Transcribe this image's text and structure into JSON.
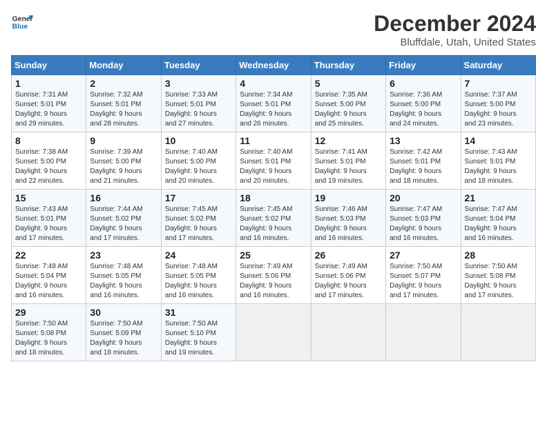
{
  "logo": {
    "line1": "General",
    "line2": "Blue"
  },
  "title": "December 2024",
  "subtitle": "Bluffdale, Utah, United States",
  "days_of_week": [
    "Sunday",
    "Monday",
    "Tuesday",
    "Wednesday",
    "Thursday",
    "Friday",
    "Saturday"
  ],
  "weeks": [
    [
      {
        "day": "1",
        "info": "Sunrise: 7:31 AM\nSunset: 5:01 PM\nDaylight: 9 hours\nand 29 minutes."
      },
      {
        "day": "2",
        "info": "Sunrise: 7:32 AM\nSunset: 5:01 PM\nDaylight: 9 hours\nand 28 minutes."
      },
      {
        "day": "3",
        "info": "Sunrise: 7:33 AM\nSunset: 5:01 PM\nDaylight: 9 hours\nand 27 minutes."
      },
      {
        "day": "4",
        "info": "Sunrise: 7:34 AM\nSunset: 5:01 PM\nDaylight: 9 hours\nand 26 minutes."
      },
      {
        "day": "5",
        "info": "Sunrise: 7:35 AM\nSunset: 5:00 PM\nDaylight: 9 hours\nand 25 minutes."
      },
      {
        "day": "6",
        "info": "Sunrise: 7:36 AM\nSunset: 5:00 PM\nDaylight: 9 hours\nand 24 minutes."
      },
      {
        "day": "7",
        "info": "Sunrise: 7:37 AM\nSunset: 5:00 PM\nDaylight: 9 hours\nand 23 minutes."
      }
    ],
    [
      {
        "day": "8",
        "info": "Sunrise: 7:38 AM\nSunset: 5:00 PM\nDaylight: 9 hours\nand 22 minutes."
      },
      {
        "day": "9",
        "info": "Sunrise: 7:39 AM\nSunset: 5:00 PM\nDaylight: 9 hours\nand 21 minutes."
      },
      {
        "day": "10",
        "info": "Sunrise: 7:40 AM\nSunset: 5:00 PM\nDaylight: 9 hours\nand 20 minutes."
      },
      {
        "day": "11",
        "info": "Sunrise: 7:40 AM\nSunset: 5:01 PM\nDaylight: 9 hours\nand 20 minutes."
      },
      {
        "day": "12",
        "info": "Sunrise: 7:41 AM\nSunset: 5:01 PM\nDaylight: 9 hours\nand 19 minutes."
      },
      {
        "day": "13",
        "info": "Sunrise: 7:42 AM\nSunset: 5:01 PM\nDaylight: 9 hours\nand 18 minutes."
      },
      {
        "day": "14",
        "info": "Sunrise: 7:43 AM\nSunset: 5:01 PM\nDaylight: 9 hours\nand 18 minutes."
      }
    ],
    [
      {
        "day": "15",
        "info": "Sunrise: 7:43 AM\nSunset: 5:01 PM\nDaylight: 9 hours\nand 17 minutes."
      },
      {
        "day": "16",
        "info": "Sunrise: 7:44 AM\nSunset: 5:02 PM\nDaylight: 9 hours\nand 17 minutes."
      },
      {
        "day": "17",
        "info": "Sunrise: 7:45 AM\nSunset: 5:02 PM\nDaylight: 9 hours\nand 17 minutes."
      },
      {
        "day": "18",
        "info": "Sunrise: 7:45 AM\nSunset: 5:02 PM\nDaylight: 9 hours\nand 16 minutes."
      },
      {
        "day": "19",
        "info": "Sunrise: 7:46 AM\nSunset: 5:03 PM\nDaylight: 9 hours\nand 16 minutes."
      },
      {
        "day": "20",
        "info": "Sunrise: 7:47 AM\nSunset: 5:03 PM\nDaylight: 9 hours\nand 16 minutes."
      },
      {
        "day": "21",
        "info": "Sunrise: 7:47 AM\nSunset: 5:04 PM\nDaylight: 9 hours\nand 16 minutes."
      }
    ],
    [
      {
        "day": "22",
        "info": "Sunrise: 7:48 AM\nSunset: 5:04 PM\nDaylight: 9 hours\nand 16 minutes."
      },
      {
        "day": "23",
        "info": "Sunrise: 7:48 AM\nSunset: 5:05 PM\nDaylight: 9 hours\nand 16 minutes."
      },
      {
        "day": "24",
        "info": "Sunrise: 7:48 AM\nSunset: 5:05 PM\nDaylight: 9 hours\nand 16 minutes."
      },
      {
        "day": "25",
        "info": "Sunrise: 7:49 AM\nSunset: 5:06 PM\nDaylight: 9 hours\nand 16 minutes."
      },
      {
        "day": "26",
        "info": "Sunrise: 7:49 AM\nSunset: 5:06 PM\nDaylight: 9 hours\nand 17 minutes."
      },
      {
        "day": "27",
        "info": "Sunrise: 7:50 AM\nSunset: 5:07 PM\nDaylight: 9 hours\nand 17 minutes."
      },
      {
        "day": "28",
        "info": "Sunrise: 7:50 AM\nSunset: 5:08 PM\nDaylight: 9 hours\nand 17 minutes."
      }
    ],
    [
      {
        "day": "29",
        "info": "Sunrise: 7:50 AM\nSunset: 5:08 PM\nDaylight: 9 hours\nand 18 minutes."
      },
      {
        "day": "30",
        "info": "Sunrise: 7:50 AM\nSunset: 5:09 PM\nDaylight: 9 hours\nand 18 minutes."
      },
      {
        "day": "31",
        "info": "Sunrise: 7:50 AM\nSunset: 5:10 PM\nDaylight: 9 hours\nand 19 minutes."
      },
      {
        "day": "",
        "info": ""
      },
      {
        "day": "",
        "info": ""
      },
      {
        "day": "",
        "info": ""
      },
      {
        "day": "",
        "info": ""
      }
    ]
  ]
}
